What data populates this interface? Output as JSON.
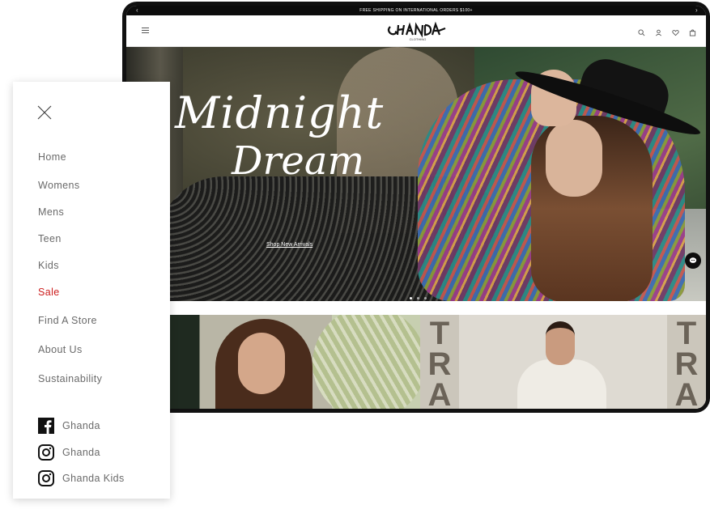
{
  "announcement": {
    "text": "FREE SHIPPING ON INTERNATIONAL ORDERS $100+",
    "prev": "‹",
    "next": "›"
  },
  "header": {
    "logo_text": "GHANDA",
    "logo_sub": "CLOTHING"
  },
  "hero": {
    "title_line1": "Midnight",
    "title_line2": "Dream",
    "cta": "Shop New Arrivals"
  },
  "tiles": {
    "stripe_letters_1": "TRA",
    "stripe_letters_2": "TRA"
  },
  "sidebar": {
    "items": [
      {
        "label": "Home"
      },
      {
        "label": "Womens"
      },
      {
        "label": "Mens"
      },
      {
        "label": "Teen"
      },
      {
        "label": "Kids"
      },
      {
        "label": "Sale"
      },
      {
        "label": "Find A Store"
      },
      {
        "label": "About Us"
      },
      {
        "label": "Sustainability"
      }
    ],
    "social": [
      {
        "label": "Ghanda",
        "icon": "facebook-icon"
      },
      {
        "label": "Ghanda",
        "icon": "instagram-icon"
      },
      {
        "label": "Ghanda Kids",
        "icon": "instagram-icon"
      }
    ]
  },
  "colors": {
    "sale": "#cc1d1d",
    "nav_text": "#6a6a6a",
    "frame": "#111111"
  }
}
